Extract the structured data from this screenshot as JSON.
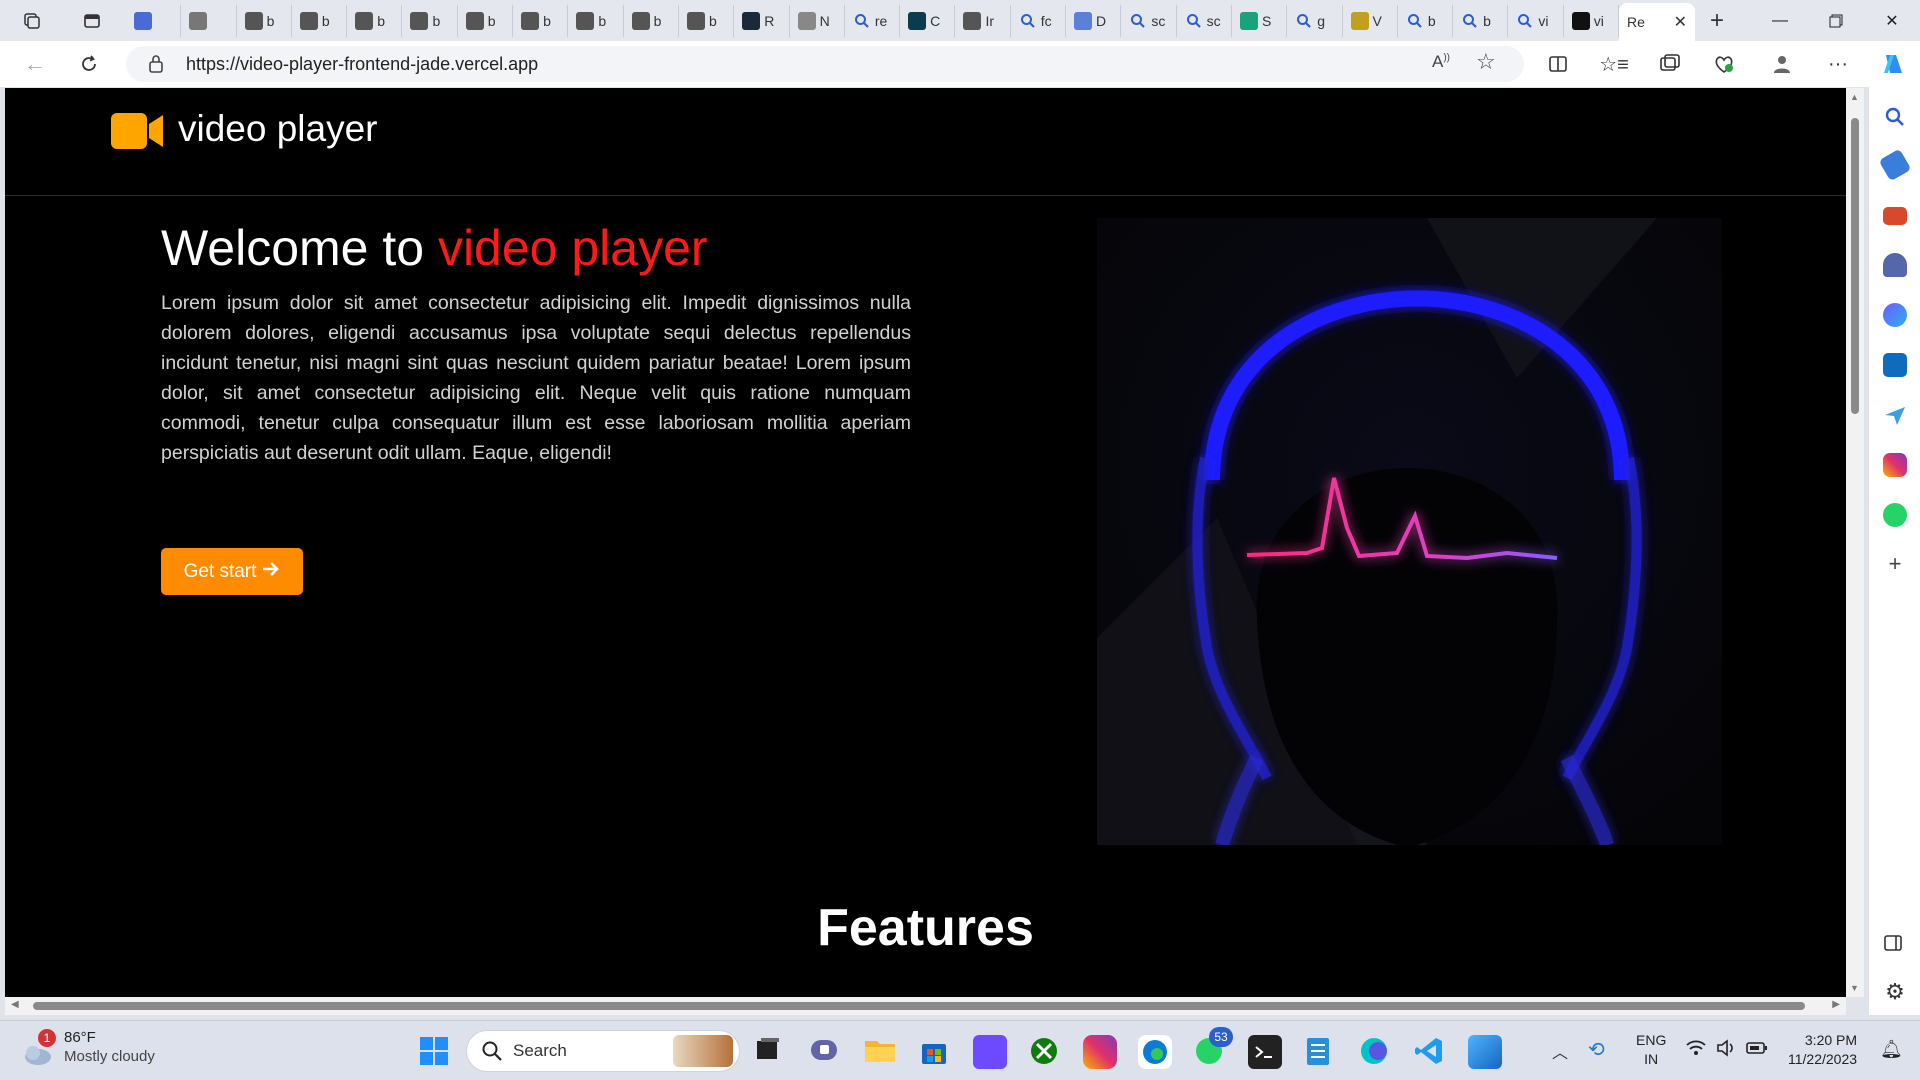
{
  "browser": {
    "tabs": [
      {
        "fav": "doc",
        "label": "",
        "color": "#4a6bd6"
      },
      {
        "fav": "b",
        "label": "",
        "color": "#777"
      },
      {
        "fav": "m",
        "label": "b",
        "color": "#555"
      },
      {
        "fav": "m",
        "label": "b",
        "color": "#555"
      },
      {
        "fav": "m",
        "label": "b",
        "color": "#555"
      },
      {
        "fav": "m",
        "label": "b",
        "color": "#555"
      },
      {
        "fav": "m",
        "label": "b",
        "color": "#555"
      },
      {
        "fav": "m",
        "label": "b",
        "color": "#555"
      },
      {
        "fav": "m",
        "label": "b",
        "color": "#555"
      },
      {
        "fav": "m",
        "label": "b",
        "color": "#555"
      },
      {
        "fav": "m",
        "label": "b",
        "color": "#555"
      },
      {
        "fav": "react",
        "label": "R",
        "color": "#1a2a3a"
      },
      {
        "fav": "n",
        "label": "N",
        "color": "#888"
      },
      {
        "fav": "search",
        "label": "re",
        "color": "#2b5fce"
      },
      {
        "fav": "c",
        "label": "C",
        "color": "#0b3c4e"
      },
      {
        "fav": "i",
        "label": "Ir",
        "color": "#555"
      },
      {
        "fav": "search",
        "label": "fc",
        "color": "#2b5fce"
      },
      {
        "fav": "d",
        "label": "D",
        "color": "#5a80d8"
      },
      {
        "fav": "search",
        "label": "sc",
        "color": "#2b5fce"
      },
      {
        "fav": "search",
        "label": "sc",
        "color": "#2b5fce"
      },
      {
        "fav": "s",
        "label": "S",
        "color": "#1aa37a"
      },
      {
        "fav": "search",
        "label": "g",
        "color": "#2b5fce"
      },
      {
        "fav": "v",
        "label": "V",
        "color": "#c0a020"
      },
      {
        "fav": "search",
        "label": "b",
        "color": "#2b5fce"
      },
      {
        "fav": "search",
        "label": "b",
        "color": "#2b5fce"
      },
      {
        "fav": "search",
        "label": "vi",
        "color": "#2b5fce"
      },
      {
        "fav": "a",
        "label": "vi",
        "color": "#111"
      }
    ],
    "active_tab_label": "Re",
    "url": "https://video-player-frontend-jade.vercel.app"
  },
  "site": {
    "logo_text": "video player",
    "hero_title_prefix": "Welcome to ",
    "hero_title_accent": "video player",
    "hero_body": "Lorem ipsum dolor sit amet consectetur adipisicing elit. Impedit dignissimos nulla dolorem dolores, eligendi accusamus ipsa voluptate sequi delectus repellendus incidunt tenetur, nisi magni sint quas nesciunt quidem pariatur beatae! Lorem ipsum dolor, sit amet consectetur adipisicing elit. Neque velit quis ratione numquam commodi, tenetur culpa consequatur illum est esse laboriosam mollitia aperiam perspiciatis aut deserunt odit ullam. Eaque, eligendi!",
    "cta_label": "Get start",
    "features_title": "Features",
    "colors": {
      "accent": "#ff1a1a",
      "button": "#ff8c00",
      "logo": "#ffa500",
      "background": "#000000"
    }
  },
  "taskbar": {
    "weather_temp": "86°F",
    "weather_desc": "Mostly cloudy",
    "weather_badge": "1",
    "search_placeholder": "Search",
    "whatsapp_badge": "53",
    "lang_top": "ENG",
    "lang_bottom": "IN",
    "time": "3:20 PM",
    "date": "11/22/2023"
  }
}
